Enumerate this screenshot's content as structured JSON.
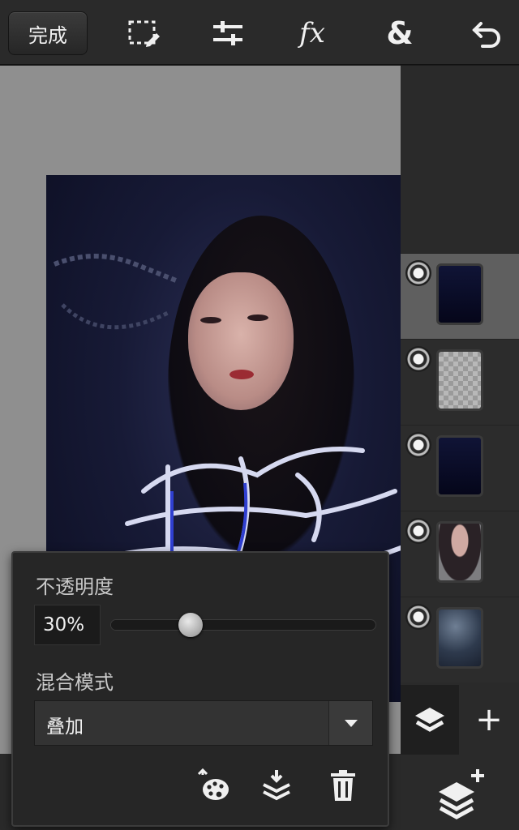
{
  "toolbar": {
    "done_label": "完成",
    "tools": [
      {
        "name": "selection-icon"
      },
      {
        "name": "adjust-icon"
      },
      {
        "name": "fx-icon",
        "label": "fx"
      },
      {
        "name": "blend-layer-icon",
        "label": "&"
      },
      {
        "name": "undo-icon"
      }
    ]
  },
  "layers": [
    {
      "thumbnail": "dark-blue-fill",
      "selected": true
    },
    {
      "thumbnail": "transparent-sparkles",
      "selected": false
    },
    {
      "thumbnail": "dark-blue-fill",
      "selected": false
    },
    {
      "thumbnail": "portrait",
      "selected": false
    },
    {
      "thumbnail": "blue-texture",
      "selected": false
    }
  ],
  "layer_panel": {
    "add_label": "+",
    "icons": [
      "layers-icon",
      "add-icon",
      "new-layer-icon"
    ]
  },
  "properties": {
    "opacity_label": "不透明度",
    "opacity_value": "30%",
    "opacity_fraction": 0.3,
    "blend_label": "混合模式",
    "blend_value": "叠加",
    "actions": [
      "palette-icon",
      "merge-down-icon",
      "trash-icon"
    ]
  },
  "colors": {
    "toolbar_bg": "#2a2a2a",
    "canvas_bg": "#8f8f8f",
    "panel_bg": "#262626",
    "selected_layer_bg": "#5f5f5f",
    "text": "#f0f0f0"
  }
}
